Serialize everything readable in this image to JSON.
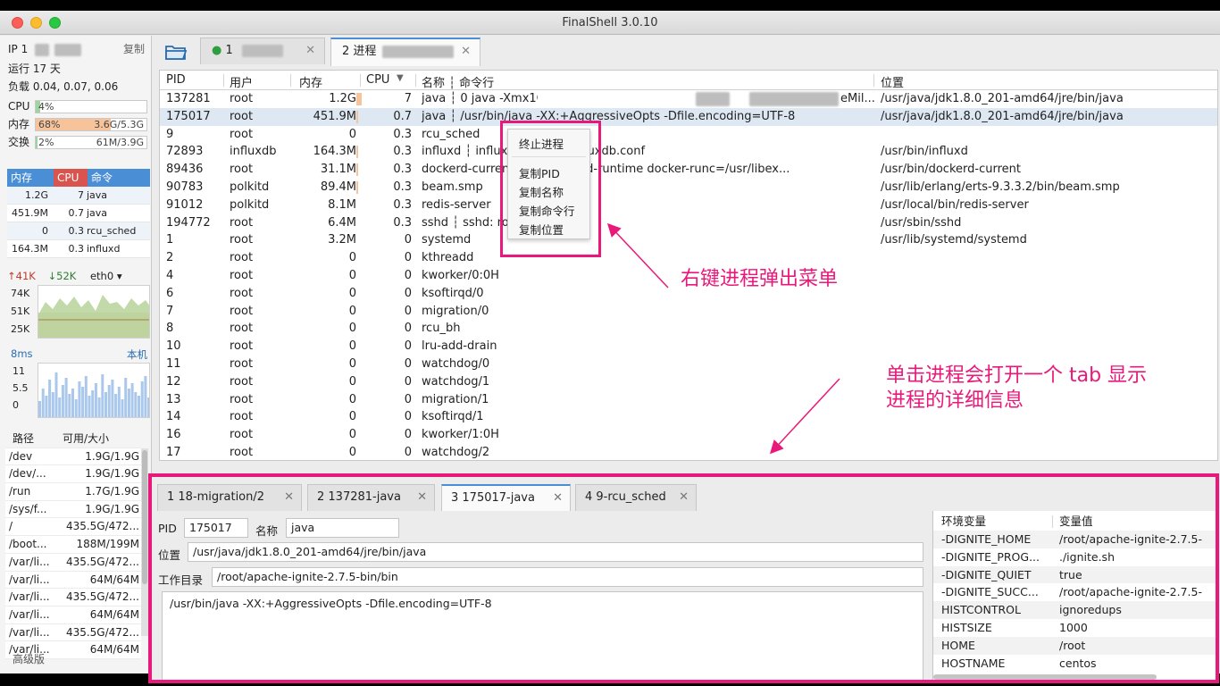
{
  "window": {
    "title": "FinalShell 3.0.10"
  },
  "sidebar": {
    "ip_label": "IP 1",
    "copy_label": "复制",
    "uptime": "运行 17 天",
    "load": "负载 0.04, 0.07, 0.06",
    "cpu": {
      "label": "CPU",
      "text": "4%",
      "fraction": 0.04
    },
    "mem": {
      "label": "内存",
      "text": "68%",
      "value": "3.6G/5.3G",
      "fraction": 0.68
    },
    "swap": {
      "label": "交换",
      "text": "2%",
      "value": "61M/3.9G",
      "fraction": 0.02
    },
    "proc_header": {
      "mem": "内存",
      "cpu": "CPU",
      "cmd": "命令"
    },
    "proc_rows": [
      {
        "mem": "1.2G",
        "cpu": "7",
        "cmd": "java"
      },
      {
        "mem": "451.9M",
        "cpu": "0.7",
        "cmd": "java"
      },
      {
        "mem": "0",
        "cpu": "0.3",
        "cmd": "rcu_sched"
      },
      {
        "mem": "164.3M",
        "cpu": "0.3",
        "cmd": "influxd"
      }
    ],
    "net": {
      "up": "41K",
      "down": "52K",
      "iface": "eth0",
      "ticks": [
        "74K",
        "51K",
        "25K"
      ]
    },
    "ping": {
      "latency": "8ms",
      "host": "本机",
      "ticks": [
        "11",
        "5.5",
        "0"
      ]
    },
    "fs_header": {
      "path": "路径",
      "avail": "可用/大小"
    },
    "fs_rows": [
      {
        "path": "/dev",
        "avail": "1.9G/1.9G"
      },
      {
        "path": "/dev/...",
        "avail": "1.9G/1.9G"
      },
      {
        "path": "/run",
        "avail": "1.7G/1.9G"
      },
      {
        "path": "/sys/f...",
        "avail": "1.9G/1.9G"
      },
      {
        "path": "/",
        "avail": "435.5G/472..."
      },
      {
        "path": "/boot...",
        "avail": "188M/199M"
      },
      {
        "path": "/var/li...",
        "avail": "435.5G/472..."
      },
      {
        "path": "/var/li...",
        "avail": "64M/64M"
      },
      {
        "path": "/var/li...",
        "avail": "435.5G/472..."
      },
      {
        "path": "/var/li...",
        "avail": "64M/64M"
      },
      {
        "path": "/var/li...",
        "avail": "435.5G/472..."
      },
      {
        "path": "/var/li...",
        "avail": "64M/64M"
      }
    ],
    "advanced": "高级版"
  },
  "tabs": [
    {
      "label": "1",
      "active": false
    },
    {
      "label": "2 进程",
      "active": true
    }
  ],
  "process_table": {
    "headers": {
      "pid": "PID",
      "user": "用户",
      "mem": "内存",
      "cpu": "CPU",
      "name": "名称 ┆ 命令行",
      "loc": "位置"
    },
    "rows": [
      {
        "pid": "137281",
        "user": "root",
        "mem": "1.2G",
        "cpu": "7",
        "name": "java ┆ 0 java -Xmx1G -Xms1G -server -XX:+U",
        "loc": "/usr/java/jdk1.8.0_201-amd64/jre/bin/java"
      },
      {
        "pid": "175017",
        "user": "root",
        "mem": "451.9M",
        "cpu": "0.7",
        "name": "java ┆ /usr/bin/java -XX:+AggressiveOpts -Dfile.encoding=UTF-8",
        "loc": "/usr/java/jdk1.8.0_201-amd64/jre/bin/java"
      },
      {
        "pid": "9",
        "user": "root",
        "mem": "0",
        "cpu": "0.3",
        "name": "rcu_sched",
        "loc": ""
      },
      {
        "pid": "72893",
        "user": "influxdb",
        "mem": "164.3M",
        "cpu": "0.3",
        "name": "influxd ┆ influxd            influxdb/influxdb.conf",
        "loc": "/usr/bin/influxd"
      },
      {
        "pid": "89436",
        "user": "root",
        "mem": "31.1M",
        "cpu": "0.3",
        "name": "dockerd-current              current --add-runtime docker-runc=/usr/libex...",
        "loc": "/usr/bin/dockerd-current"
      },
      {
        "pid": "90783",
        "user": "polkitd",
        "mem": "89.4M",
        "cpu": "0.3",
        "name": "beam.smp",
        "loc": "/usr/lib/erlang/erts-9.3.3.2/bin/beam.smp"
      },
      {
        "pid": "91012",
        "user": "polkitd",
        "mem": "8.1M",
        "cpu": "0.3",
        "name": "redis-server",
        "loc": "/usr/local/bin/redis-server"
      },
      {
        "pid": "194772",
        "user": "root",
        "mem": "6.4M",
        "cpu": "0.3",
        "name": "sshd ┆ sshd: ro",
        "loc": "/usr/sbin/sshd"
      },
      {
        "pid": "1",
        "user": "root",
        "mem": "3.2M",
        "cpu": "0",
        "name": "systemd",
        "loc": "/usr/lib/systemd/systemd"
      },
      {
        "pid": "2",
        "user": "root",
        "mem": "0",
        "cpu": "0",
        "name": "kthreadd",
        "loc": ""
      },
      {
        "pid": "4",
        "user": "root",
        "mem": "0",
        "cpu": "0",
        "name": "kworker/0:0H",
        "loc": ""
      },
      {
        "pid": "6",
        "user": "root",
        "mem": "0",
        "cpu": "0",
        "name": "ksoftirqd/0",
        "loc": ""
      },
      {
        "pid": "7",
        "user": "root",
        "mem": "0",
        "cpu": "0",
        "name": "migration/0",
        "loc": ""
      },
      {
        "pid": "8",
        "user": "root",
        "mem": "0",
        "cpu": "0",
        "name": "rcu_bh",
        "loc": ""
      },
      {
        "pid": "10",
        "user": "root",
        "mem": "0",
        "cpu": "0",
        "name": "lru-add-drain",
        "loc": ""
      },
      {
        "pid": "11",
        "user": "root",
        "mem": "0",
        "cpu": "0",
        "name": "watchdog/0",
        "loc": ""
      },
      {
        "pid": "12",
        "user": "root",
        "mem": "0",
        "cpu": "0",
        "name": "watchdog/1",
        "loc": ""
      },
      {
        "pid": "13",
        "user": "root",
        "mem": "0",
        "cpu": "0",
        "name": "migration/1",
        "loc": ""
      },
      {
        "pid": "14",
        "user": "root",
        "mem": "0",
        "cpu": "0",
        "name": "ksoftirqd/1",
        "loc": ""
      },
      {
        "pid": "16",
        "user": "root",
        "mem": "0",
        "cpu": "0",
        "name": "kworker/1:0H",
        "loc": ""
      },
      {
        "pid": "17",
        "user": "root",
        "mem": "0",
        "cpu": "0",
        "name": "watchdog/2",
        "loc": ""
      }
    ]
  },
  "context_menu": {
    "items": [
      "终止进程",
      "复制PID",
      "复制名称",
      "复制命令行",
      "复制位置"
    ]
  },
  "annotations": {
    "right_click": "右键进程弹出菜单",
    "click_line1": "单击进程会打开一个 tab 显示",
    "click_line2": "进程的详细信息"
  },
  "detail_tabs": [
    {
      "label": "1 18-migration/2",
      "active": false
    },
    {
      "label": "2 137281-java",
      "active": false
    },
    {
      "label": "3 175017-java",
      "active": true
    },
    {
      "label": "4 9-rcu_sched",
      "active": false
    }
  ],
  "detail": {
    "pid_label": "PID",
    "pid": "175017",
    "name_label": "名称",
    "name": "java",
    "loc_label": "位置",
    "loc": "/usr/java/jdk1.8.0_201-amd64/jre/bin/java",
    "cwd_label": "工作目录",
    "cwd": "/root/apache-ignite-2.7.5-bin/bin",
    "cmdline": "/usr/bin/java -XX:+AggressiveOpts -Dfile.encoding=UTF-8"
  },
  "env": {
    "headers": {
      "key": "环境变量",
      "value": "变量值"
    },
    "rows": [
      {
        "key": "-DIGNITE_HOME",
        "value": "/root/apache-ignite-2.7.5-"
      },
      {
        "key": "-DIGNITE_PROG...",
        "value": "./ignite.sh"
      },
      {
        "key": "-DIGNITE_QUIET",
        "value": "true"
      },
      {
        "key": "-DIGNITE_SUCC...",
        "value": "/root/apache-ignite-2.7.5-"
      },
      {
        "key": "HISTCONTROL",
        "value": "ignoredups"
      },
      {
        "key": "HISTSIZE",
        "value": "1000"
      },
      {
        "key": "HOME",
        "value": "/root"
      },
      {
        "key": "HOSTNAME",
        "value": "centos"
      }
    ]
  },
  "colors": {
    "accent": "#4a8fd6",
    "annotation": "#e8197a",
    "mem_bar": "#f6c39a",
    "cpu_bar": "#e3e3e3"
  }
}
